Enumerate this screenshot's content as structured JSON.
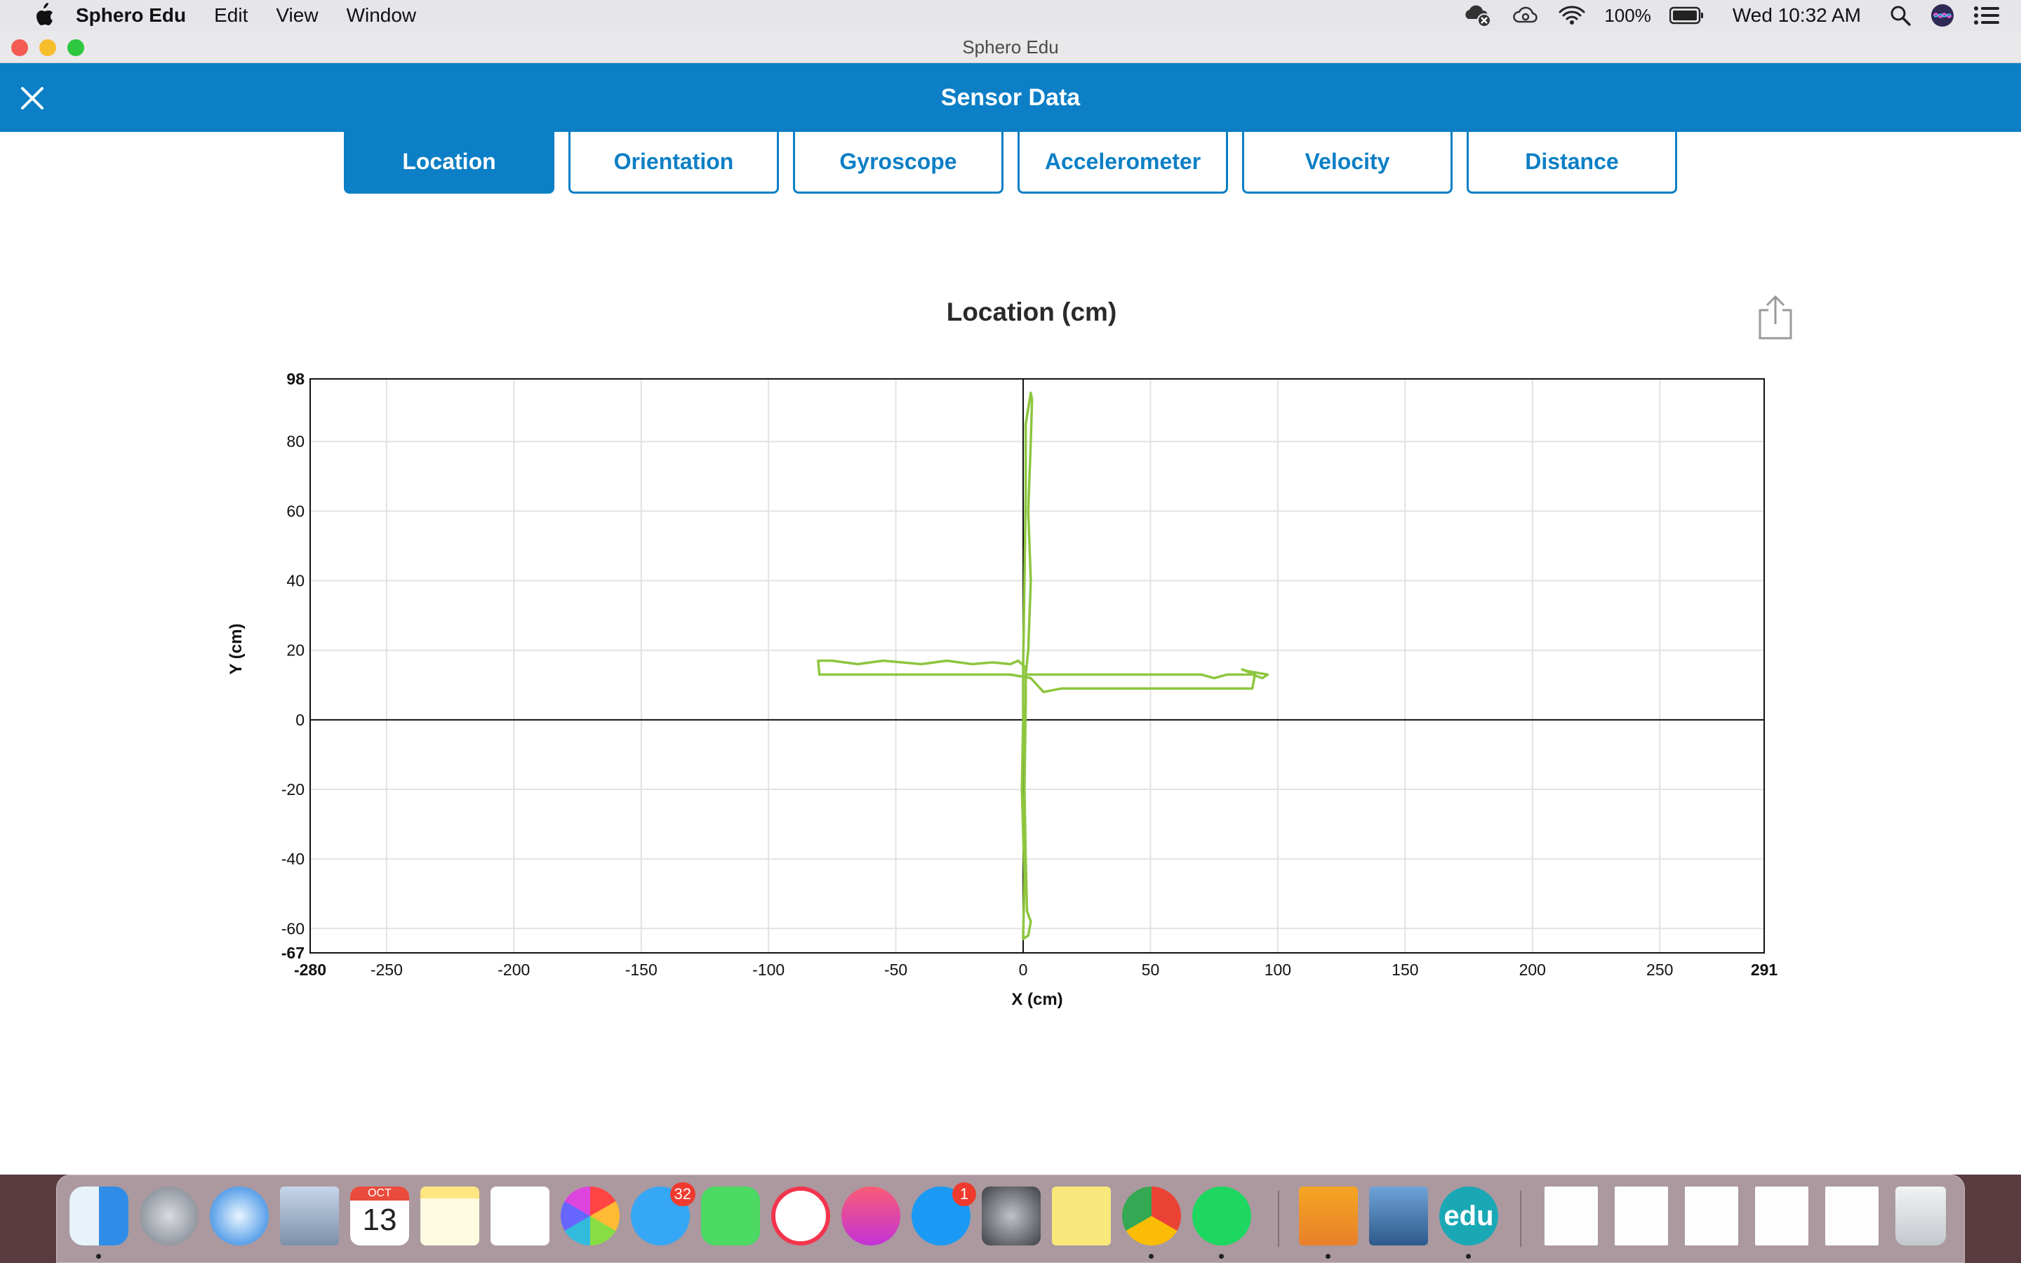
{
  "menubar": {
    "app_name": "Sphero Edu",
    "menus": [
      "Edit",
      "View",
      "Window"
    ],
    "battery": "100%",
    "clock": "Wed 10:32 AM"
  },
  "window": {
    "title": "Sphero Edu",
    "header_title": "Sensor Data"
  },
  "tabs": [
    {
      "label": "Location",
      "active": true
    },
    {
      "label": "Orientation",
      "active": false
    },
    {
      "label": "Gyroscope",
      "active": false
    },
    {
      "label": "Accelerometer",
      "active": false
    },
    {
      "label": "Velocity",
      "active": false
    },
    {
      "label": "Distance",
      "active": false
    }
  ],
  "chart_data": {
    "type": "line",
    "title": "Location (cm)",
    "xlabel": "X (cm)",
    "ylabel": "Y (cm)",
    "xlim": [
      -280,
      291
    ],
    "ylim": [
      -67,
      98
    ],
    "x_ticks": [
      -280,
      -250,
      -200,
      -150,
      -100,
      -50,
      0,
      50,
      100,
      150,
      200,
      250,
      291
    ],
    "y_ticks": [
      98,
      80,
      60,
      40,
      20,
      0,
      -20,
      -40,
      -60,
      -67
    ],
    "grid": true,
    "series_color": "#8dc63f",
    "path_points": [
      [
        0,
        0
      ],
      [
        0,
        15
      ],
      [
        0.5,
        40
      ],
      [
        1,
        65
      ],
      [
        1,
        85
      ],
      [
        3,
        94
      ],
      [
        3.5,
        92
      ],
      [
        3,
        80
      ],
      [
        2,
        60
      ],
      [
        3,
        40
      ],
      [
        2,
        20
      ],
      [
        1,
        13
      ],
      [
        20,
        13
      ],
      [
        50,
        13
      ],
      [
        70,
        13
      ],
      [
        75,
        12
      ],
      [
        80,
        13
      ],
      [
        90,
        13
      ],
      [
        94,
        12
      ],
      [
        96,
        13
      ],
      [
        88,
        14
      ],
      [
        86,
        14.5
      ],
      [
        91,
        13
      ],
      [
        90,
        9
      ],
      [
        70,
        9
      ],
      [
        55,
        9
      ],
      [
        40,
        9
      ],
      [
        25,
        9
      ],
      [
        15,
        9
      ],
      [
        8,
        8
      ],
      [
        3,
        12
      ],
      [
        -5,
        13
      ],
      [
        -30,
        13
      ],
      [
        -50,
        13
      ],
      [
        -70,
        13
      ],
      [
        -80,
        13
      ],
      [
        -80.5,
        17
      ],
      [
        -75,
        17
      ],
      [
        -65,
        16
      ],
      [
        -55,
        17
      ],
      [
        -40,
        16
      ],
      [
        -30,
        17
      ],
      [
        -20,
        16
      ],
      [
        -12,
        16.5
      ],
      [
        -5,
        16
      ],
      [
        -2,
        17
      ],
      [
        1,
        15
      ],
      [
        1,
        5
      ],
      [
        0.5,
        -20
      ],
      [
        1,
        -40
      ],
      [
        1.5,
        -55
      ],
      [
        3,
        -58
      ],
      [
        2,
        -62
      ],
      [
        0,
        -63
      ],
      [
        0.5,
        -45
      ],
      [
        -0.5,
        -20
      ],
      [
        0,
        0
      ]
    ]
  },
  "dock": {
    "messages_badge": "32",
    "appstore_badge": "1",
    "calendar_month": "OCT",
    "calendar_day": "13",
    "edu_label": "edu"
  }
}
